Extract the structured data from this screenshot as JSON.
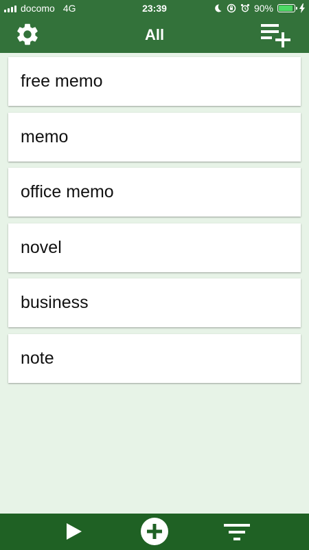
{
  "status_bar": {
    "carrier": "docomo",
    "network": "4G",
    "time": "23:39",
    "battery_percent": "90%",
    "battery_level": 0.9,
    "icons": [
      "signal-icon",
      "moon-icon",
      "orientation-lock-icon",
      "alarm-icon",
      "battery-icon",
      "charging-icon"
    ]
  },
  "header": {
    "title": "All",
    "left_icon": "gear-icon",
    "right_icon": "add-list-icon"
  },
  "list": {
    "items": [
      {
        "label": "free memo"
      },
      {
        "label": "memo"
      },
      {
        "label": "office memo"
      },
      {
        "label": "novel"
      },
      {
        "label": "business"
      },
      {
        "label": "note"
      }
    ]
  },
  "bottom_bar": {
    "icons": [
      "play-icon",
      "add-circle-icon",
      "filter-icon"
    ]
  },
  "colors": {
    "header_bg": "#33723a",
    "bottom_bar_bg": "#1f6124",
    "page_bg": "#e7f3e7",
    "battery_green": "#4cd964"
  }
}
